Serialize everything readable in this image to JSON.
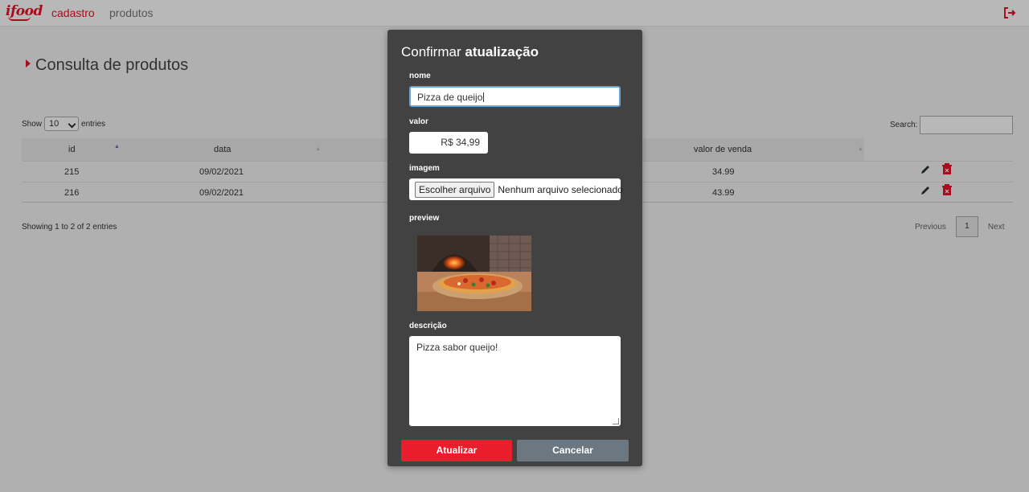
{
  "nav": {
    "logo": "ifood",
    "links": [
      "cadastro",
      "produtos"
    ]
  },
  "page": {
    "title": "Consulta de produtos"
  },
  "datatable": {
    "show_label": "Show",
    "entries_label": "entries",
    "page_size": "10",
    "search_label": "Search:",
    "columns": [
      "id",
      "data",
      "valor de venda"
    ],
    "rows": [
      {
        "id": "215",
        "data": "09/02/2021",
        "valor": "34.99"
      },
      {
        "id": "216",
        "data": "09/02/2021",
        "valor": "43.99"
      }
    ],
    "info": "Showing 1 to 2 of 2 entries",
    "pager": {
      "previous": "Previous",
      "current": "1",
      "next": "Next"
    }
  },
  "modal": {
    "title_plain": "Confirmar ",
    "title_bold": "atualização",
    "nome_label": "nome",
    "nome_value": "Pizza de queijo",
    "valor_label": "valor",
    "valor_value": "R$ 34,99",
    "imagem_label": "imagem",
    "file_button": "Escolher arquivo",
    "file_status": "Nenhum arquivo selecionado",
    "preview_label": "preview",
    "descricao_label": "descrição",
    "descricao_value": "Pizza sabor queijo!",
    "update_button": "Atualizar",
    "cancel_button": "Cancelar"
  },
  "colors": {
    "brand_red": "#ea1d2c",
    "modal_bg": "#424242",
    "cancel_gray": "#6b7882"
  },
  "icons": [
    "logout-icon",
    "edit-icon",
    "delete-icon",
    "sort-asc-icon",
    "sort-icon"
  ]
}
